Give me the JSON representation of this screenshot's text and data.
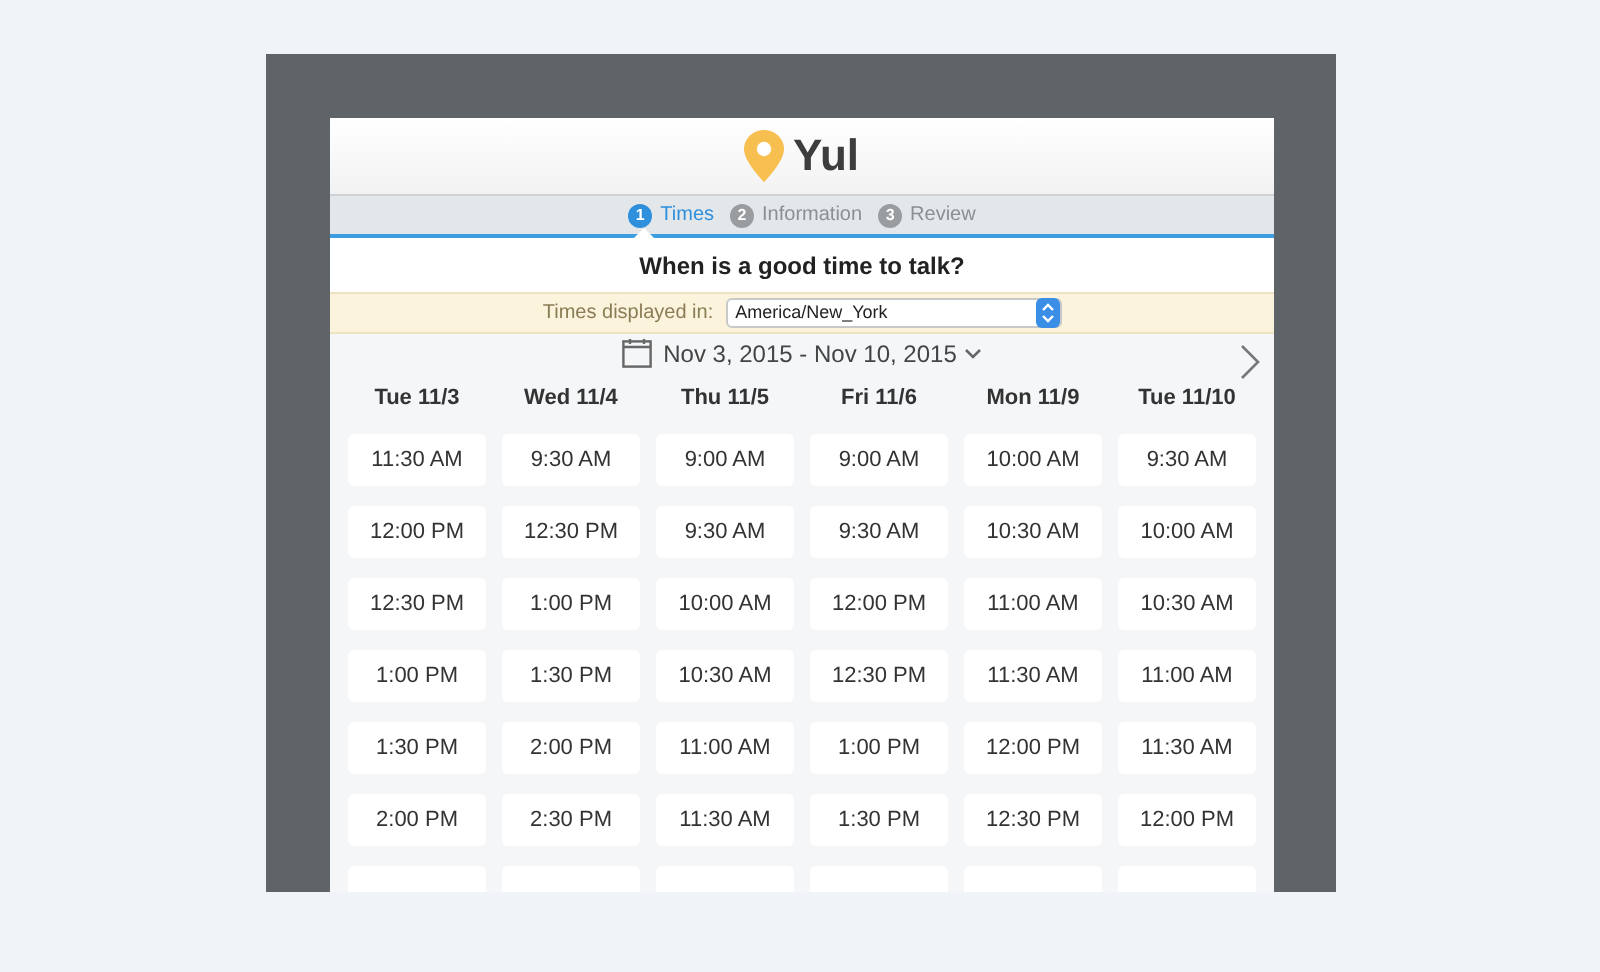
{
  "logo": {
    "text": "Yul"
  },
  "steps": [
    {
      "number": "1",
      "label": "Times",
      "selected": true
    },
    {
      "number": "2",
      "label": "Information",
      "selected": false
    },
    {
      "number": "3",
      "label": "Review",
      "selected": false
    }
  ],
  "question": "When is a good time to talk?",
  "timezone": {
    "label": "Times displayed in:",
    "value": "America/New_York"
  },
  "date_range": "Nov 3, 2015 - Nov 10, 2015",
  "days": [
    {
      "heading": "Tue 11/3",
      "times": [
        "11:30 AM",
        "12:00 PM",
        "12:30 PM",
        "1:00 PM",
        "1:30 PM",
        "2:00 PM"
      ]
    },
    {
      "heading": "Wed 11/4",
      "times": [
        "9:30 AM",
        "12:30 PM",
        "1:00 PM",
        "1:30 PM",
        "2:00 PM",
        "2:30 PM"
      ]
    },
    {
      "heading": "Thu 11/5",
      "times": [
        "9:00 AM",
        "9:30 AM",
        "10:00 AM",
        "10:30 AM",
        "11:00 AM",
        "11:30 AM"
      ]
    },
    {
      "heading": "Fri 11/6",
      "times": [
        "9:00 AM",
        "9:30 AM",
        "12:00 PM",
        "12:30 PM",
        "1:00 PM",
        "1:30 PM"
      ]
    },
    {
      "heading": "Mon 11/9",
      "times": [
        "10:00 AM",
        "10:30 AM",
        "11:00 AM",
        "11:30 AM",
        "12:00 PM",
        "12:30 PM"
      ]
    },
    {
      "heading": "Tue 11/10",
      "times": [
        "9:30 AM",
        "10:00 AM",
        "10:30 AM",
        "11:00 AM",
        "11:30 AM",
        "12:00 PM"
      ]
    }
  ]
}
